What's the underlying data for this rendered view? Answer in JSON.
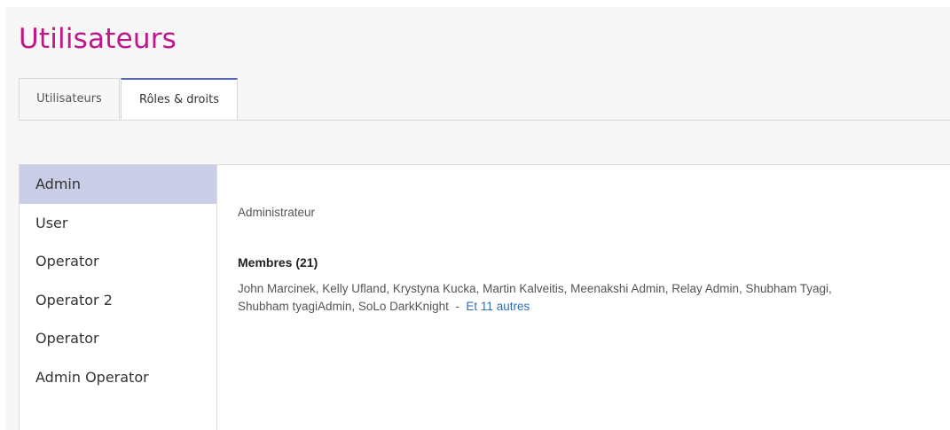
{
  "header": {
    "title": "Utilisateurs"
  },
  "tabs": [
    {
      "label": "Utilisateurs",
      "active": false
    },
    {
      "label": "Rôles & droits",
      "active": true
    }
  ],
  "roles": [
    {
      "label": "Admin",
      "active": true
    },
    {
      "label": "User",
      "active": false
    },
    {
      "label": "Operator",
      "active": false
    },
    {
      "label": "Operator 2",
      "active": false
    },
    {
      "label": "Operator",
      "active": false
    },
    {
      "label": "Admin Operator",
      "active": false
    }
  ],
  "detail": {
    "description": "Administrateur",
    "members_title": "Membres (21)",
    "members_line1": "John Marcinek, Kelly Ufland, Krystyna Kucka, Martin Kalveitis, Meenakshi Admin, Relay Admin, Shubham Tyagi,",
    "members_line2": "Shubham tyagiAdmin, SoLo DarkKnight",
    "separator": "-",
    "more_link": "Et 11 autres"
  },
  "colors": {
    "title": "#c0168a",
    "active_role_bg": "#c9cde8",
    "active_tab_border": "#5a6bb5",
    "link": "#2a6fb3"
  }
}
